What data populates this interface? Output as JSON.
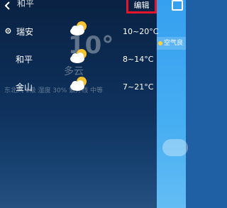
{
  "header": {
    "back_icon": "chevron-left-icon",
    "title": "和平",
    "edit_label": "编辑"
  },
  "background": {
    "current_temp": "10°",
    "condition": "多云",
    "extra_info": "东北风 1级   湿度 30%   紫外线 中等"
  },
  "cities": [
    {
      "name": "瑞安",
      "located": true,
      "icon": "partly-cloudy-icon",
      "range": "10~20°C"
    },
    {
      "name": "和平",
      "located": false,
      "icon": "partly-cloudy-icon",
      "range": "8~14°C"
    },
    {
      "name": "金山",
      "located": false,
      "icon": "partly-cloudy-icon",
      "range": "7~21°C"
    }
  ],
  "right_pane": {
    "air_quality": "空气良"
  },
  "colors": {
    "highlight_border": "#e8152a",
    "sun": "#f6c231",
    "cloud": "#ffffff"
  }
}
